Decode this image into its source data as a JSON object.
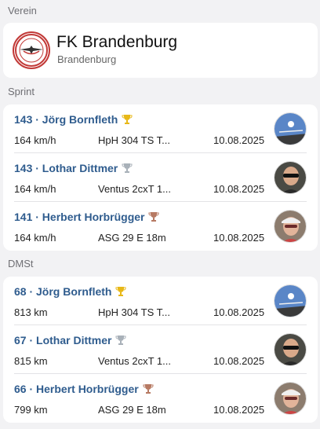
{
  "club": {
    "section_label": "Verein",
    "name": "FK Brandenburg",
    "city": "Brandenburg",
    "logo_icon": "club-logo-eagle"
  },
  "sprint": {
    "section_label": "Sprint",
    "entries": [
      {
        "name": "143 · Jörg Bornfleth",
        "trophy": "gold",
        "value": "164 km/h",
        "glider": "HpH 304 TS T...",
        "date": "10.08.2025",
        "avatar": "glider-sky"
      },
      {
        "name": "143 · Lothar Dittmer",
        "trophy": "silver",
        "value": "164 km/h",
        "glider": "Ventus 2cxT 1...",
        "date": "10.08.2025",
        "avatar": "pilot-sunglasses"
      },
      {
        "name": "141 · Herbert Horbrügger",
        "trophy": "bronze",
        "value": "164 km/h",
        "glider": "ASG 29 E 18m",
        "date": "10.08.2025",
        "avatar": "pilot-cap"
      }
    ]
  },
  "dmst": {
    "section_label": "DMSt",
    "entries": [
      {
        "name": "68 · Jörg Bornfleth",
        "trophy": "gold",
        "value": "813 km",
        "glider": "HpH 304 TS T...",
        "date": "10.08.2025",
        "avatar": "glider-sky"
      },
      {
        "name": "67 · Lothar Dittmer",
        "trophy": "silver",
        "value": "815 km",
        "glider": "Ventus 2cxT 1...",
        "date": "10.08.2025",
        "avatar": "pilot-sunglasses"
      },
      {
        "name": "66 · Herbert Horbrügger",
        "trophy": "bronze",
        "value": "799 km",
        "glider": "ASG 29 E 18m",
        "date": "10.08.2025",
        "avatar": "pilot-cap"
      }
    ]
  },
  "colors": {
    "gold": "#e8b817",
    "silver": "#a9b1b9",
    "bronze": "#b77a63",
    "name": "#2f5c8e"
  }
}
